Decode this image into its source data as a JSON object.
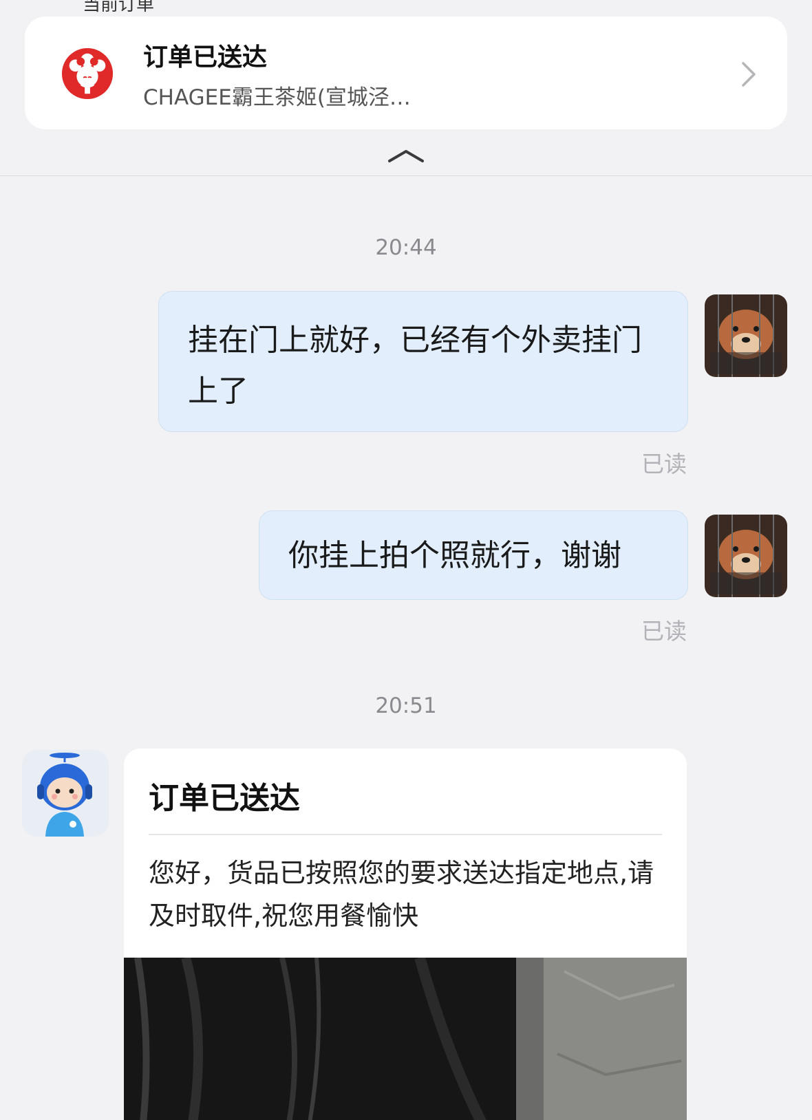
{
  "order_card": {
    "top_cut_text": "当前订单",
    "title": "订单已送达",
    "subtitle": "CHAGEE霸王茶姬(宣城泾…",
    "chevron_icon": "chevron-right-icon",
    "logo_icon": "chagee-opera-logo-icon",
    "brand_color": "#e02a2a"
  },
  "collapse_icon": "chevron-up-icon",
  "messages": [
    {
      "time": "20:44",
      "text": "挂在门上就好，已经有个外卖挂门上了",
      "status": "已读"
    },
    {
      "text": "你挂上拍个照就行，谢谢",
      "status": "已读"
    }
  ],
  "notice": {
    "time": "20:51",
    "title": "订单已送达",
    "body": "您好，货品已按照您的要求送达指定地点,请及时取件,祝您用餐愉快",
    "avatar_icon": "delivery-bot-avatar-icon"
  },
  "colors": {
    "bubble": "#e2eefc",
    "background": "#f2f2f4"
  }
}
